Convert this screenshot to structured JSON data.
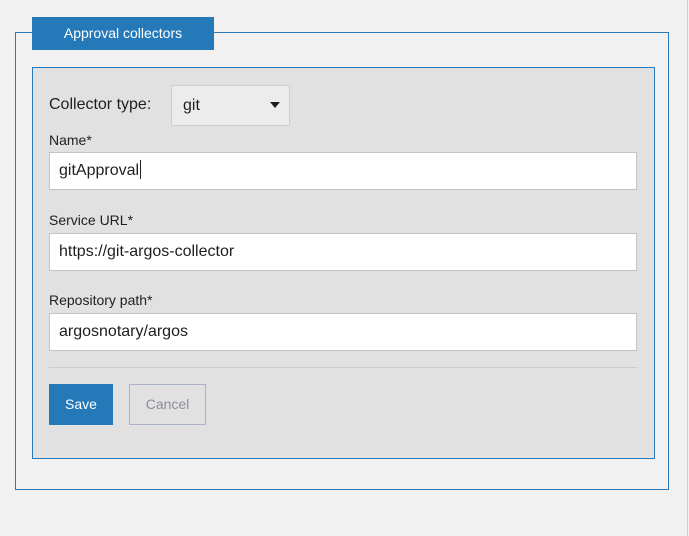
{
  "tab": {
    "label": "Approval collectors"
  },
  "form": {
    "collector_type_label": "Collector type:",
    "collector_type_value": "git",
    "name_label": "Name*",
    "name_value": "gitApproval",
    "service_url_label": "Service URL*",
    "service_url_value": "https://git-argos-collector",
    "repository_path_label": "Repository path*",
    "repository_path_value": "argosnotary/argos"
  },
  "actions": {
    "save_label": "Save",
    "cancel_label": "Cancel"
  },
  "colors": {
    "accent": "#2679b8",
    "panel_background": "#e1e1e1",
    "page_background": "#f1f1f1"
  },
  "icons": {
    "select_caret": "caret-down-icon"
  }
}
